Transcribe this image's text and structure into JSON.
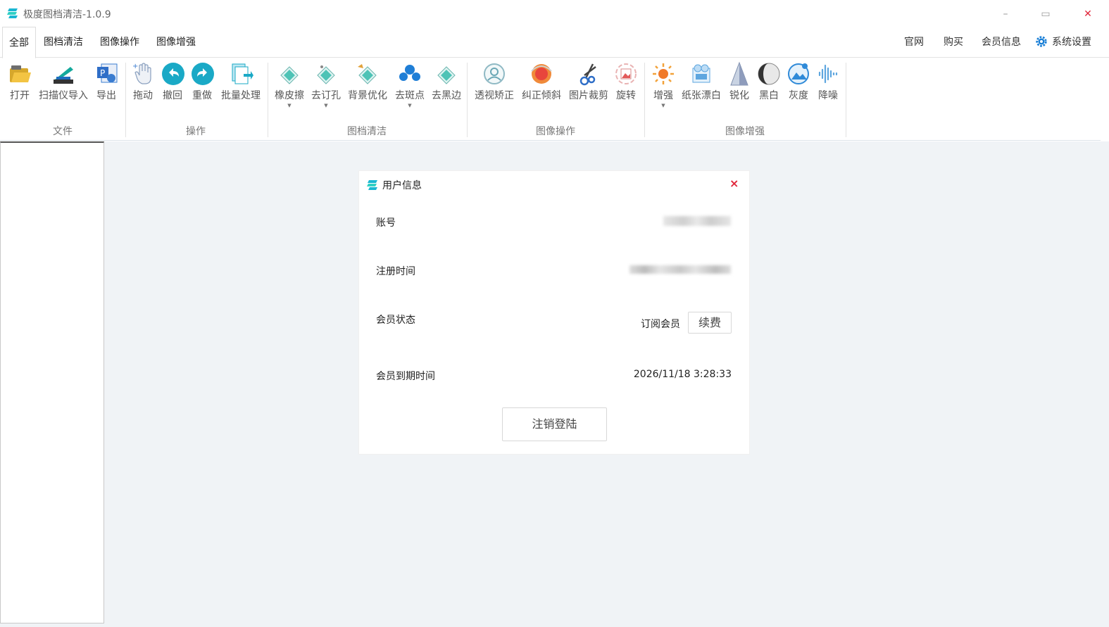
{
  "window": {
    "title": "极度图档清洁-1.0.9",
    "minimize": "–",
    "maximize": "▭",
    "close": "✕"
  },
  "menu": {
    "tabs": [
      "全部",
      "图档清洁",
      "图像操作",
      "图像增强"
    ],
    "active_tab": "全部",
    "right": {
      "website": "官网",
      "buy": "购买",
      "member_info": "会员信息",
      "settings": "系统设置"
    }
  },
  "ribbon": {
    "groups": {
      "file": "文件",
      "operation": "操作",
      "cleaning": "图档清洁",
      "image_ops": "图像操作",
      "enhance": "图像增强"
    },
    "buttons": {
      "open": "打开",
      "scanner": "扫描仪导入",
      "export": "导出",
      "drag": "拖动",
      "undo": "撤回",
      "redo": "重做",
      "batch": "批量处理",
      "eraser": "橡皮擦",
      "staple": "去订孔",
      "background": "背景优化",
      "spot": "去斑点",
      "border": "去黑边",
      "perspective": "透视矫正",
      "deskew": "纠正倾斜",
      "crop": "图片裁剪",
      "rotate": "旋转",
      "enhance": "增强",
      "whiten": "纸张漂白",
      "sharpen": "锐化",
      "bw": "黑白",
      "gray": "灰度",
      "denoise": "降噪"
    },
    "caret": "▼"
  },
  "dialog": {
    "title": "用户信息",
    "close": "×",
    "rows": {
      "account_label": "账号",
      "register_label": "注册时间",
      "status_label": "会员状态",
      "status_value": "订阅会员",
      "renew": "续费",
      "expire_label": "会员到期时间",
      "expire_value": "2026/11/18 3:28:33"
    },
    "logout": "注销登陆"
  },
  "colors": {
    "accent": "#1aa9c6",
    "logo": "#19b6d2",
    "close": "#e0263a"
  }
}
